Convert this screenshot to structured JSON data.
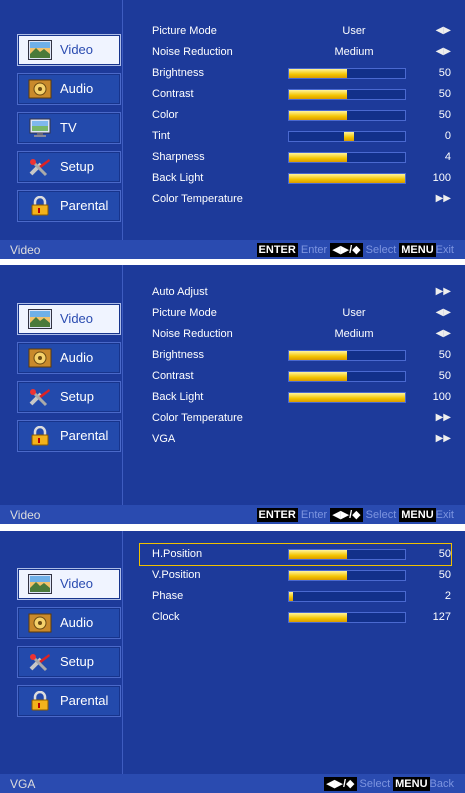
{
  "screens": [
    {
      "menu": [
        {
          "label": "Video",
          "active": true,
          "icon": "video-icon"
        },
        {
          "label": "Audio",
          "active": false,
          "icon": "audio-icon"
        },
        {
          "label": "TV",
          "active": false,
          "icon": "tv-icon"
        },
        {
          "label": "Setup",
          "active": false,
          "icon": "setup-icon"
        },
        {
          "label": "Parental",
          "active": false,
          "icon": "parental-icon"
        }
      ],
      "rows": [
        {
          "name": "Picture Mode",
          "type": "select",
          "value": "User",
          "arrow": "◀▶"
        },
        {
          "name": "Noise Reduction",
          "type": "select",
          "value": "Medium",
          "arrow": "◀▶"
        },
        {
          "name": "Brightness",
          "type": "bar",
          "value": 50
        },
        {
          "name": "Contrast",
          "type": "bar",
          "value": 50
        },
        {
          "name": "Color",
          "type": "bar",
          "value": 50
        },
        {
          "name": "Tint",
          "type": "tint",
          "value": 0
        },
        {
          "name": "Sharpness",
          "type": "bar",
          "value": 4,
          "max": 8
        },
        {
          "name": "Back Light",
          "type": "bar",
          "value": 100
        },
        {
          "name": "Color Temperature",
          "type": "submenu",
          "arrow": "▶▶"
        }
      ],
      "footer": {
        "title": "Video",
        "enter_key": "ENTER",
        "enter_hint": "Enter",
        "nav_key": "◀▶/◆",
        "select_hint": "Select",
        "menu_key": "MENU",
        "menu_hint": "Exit",
        "show_enter": true
      }
    },
    {
      "menu": [
        {
          "label": "Video",
          "active": true,
          "icon": "video-icon"
        },
        {
          "label": "Audio",
          "active": false,
          "icon": "audio-icon"
        },
        {
          "label": "Setup",
          "active": false,
          "icon": "setup-icon"
        },
        {
          "label": "Parental",
          "active": false,
          "icon": "parental-icon"
        }
      ],
      "rows": [
        {
          "name": "Auto Adjust",
          "type": "submenu",
          "arrow": "▶▶"
        },
        {
          "name": "Picture Mode",
          "type": "select",
          "value": "User",
          "arrow": "◀▶"
        },
        {
          "name": "Noise Reduction",
          "type": "select",
          "value": "Medium",
          "arrow": "◀▶"
        },
        {
          "name": "Brightness",
          "type": "bar",
          "value": 50
        },
        {
          "name": "Contrast",
          "type": "bar",
          "value": 50
        },
        {
          "name": "Back Light",
          "type": "bar",
          "value": 100
        },
        {
          "name": "Color Temperature",
          "type": "submenu",
          "arrow": "▶▶"
        },
        {
          "name": "VGA",
          "type": "submenu",
          "arrow": "▶▶"
        }
      ],
      "footer": {
        "title": "Video",
        "enter_key": "ENTER",
        "enter_hint": "Enter",
        "nav_key": "◀▶/◆",
        "select_hint": "Select",
        "menu_key": "MENU",
        "menu_hint": "Exit",
        "show_enter": true
      }
    },
    {
      "menu": [
        {
          "label": "Video",
          "active": true,
          "icon": "video-icon"
        },
        {
          "label": "Audio",
          "active": false,
          "icon": "audio-icon"
        },
        {
          "label": "Setup",
          "active": false,
          "icon": "setup-icon"
        },
        {
          "label": "Parental",
          "active": false,
          "icon": "parental-icon"
        }
      ],
      "rows": [
        {
          "name": "H.Position",
          "type": "bar",
          "value": 50,
          "highlight": true
        },
        {
          "name": "V.Position",
          "type": "bar",
          "value": 50
        },
        {
          "name": "Phase",
          "type": "bar",
          "value": 2,
          "max": 63
        },
        {
          "name": "Clock",
          "type": "bar",
          "value": 127,
          "max": 255
        }
      ],
      "footer": {
        "title": "VGA",
        "enter_key": "",
        "enter_hint": "",
        "nav_key": "◀▶/◆",
        "select_hint": "Select",
        "menu_key": "MENU",
        "menu_hint": "Back",
        "show_enter": false
      }
    }
  ],
  "colors": {
    "background": "#1d3a9a",
    "highlight": "#f0c000",
    "bar_fill": "#f3c400"
  }
}
